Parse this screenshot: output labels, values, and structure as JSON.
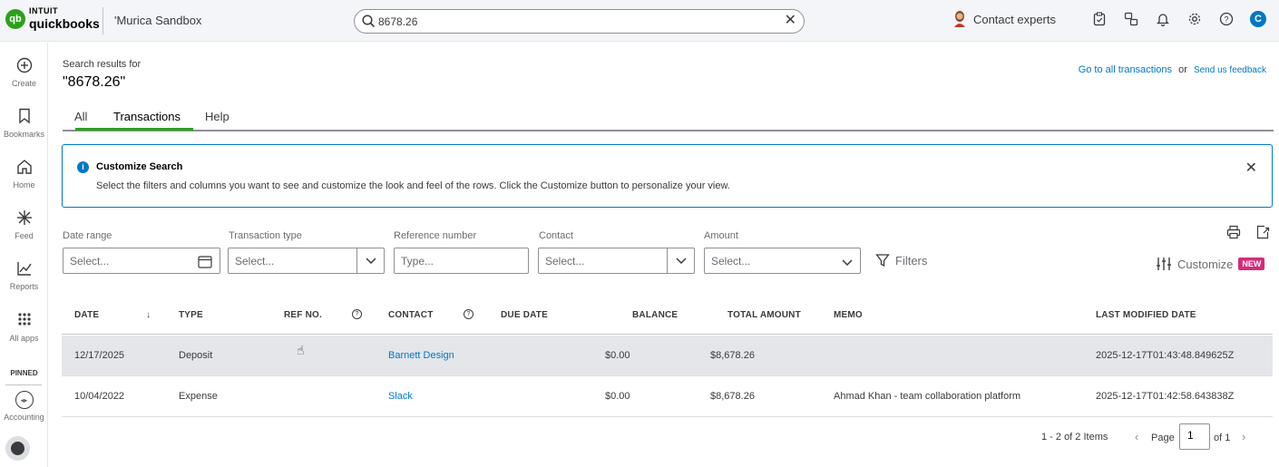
{
  "header": {
    "logo_intuit": "INTUIT",
    "logo_qb": "quickbooks",
    "company": "'Murica Sandbox",
    "search_value": "8678.26",
    "contact_experts": "Contact experts",
    "user_initial": "C"
  },
  "rail": {
    "items": [
      {
        "label": "Create"
      },
      {
        "label": "Bookmarks"
      },
      {
        "label": "Home"
      },
      {
        "label": "Feed"
      },
      {
        "label": "Reports"
      },
      {
        "label": "All apps"
      }
    ],
    "pinned_label": "PINNED",
    "pinned_items": [
      {
        "label": "Accounting"
      }
    ]
  },
  "main": {
    "search_results_label": "Search results for",
    "query": "\"8678.26\"",
    "go_to_all": "Go to all transactions",
    "or_text": "or",
    "feedback": "Send us feedback",
    "tabs": [
      {
        "label": "All"
      },
      {
        "label": "Transactions"
      },
      {
        "label": "Help"
      }
    ],
    "active_tab": "Transactions",
    "banner": {
      "title": "Customize Search",
      "text": "Select the filters and columns you want to see and customize the look and feel of the rows. Click the Customize button to personalize your view."
    },
    "filters": {
      "date_range": {
        "label": "Date range",
        "placeholder": "Select..."
      },
      "transaction_type": {
        "label": "Transaction type",
        "placeholder": "Select..."
      },
      "reference_number": {
        "label": "Reference number",
        "placeholder": "Type..."
      },
      "contact": {
        "label": "Contact",
        "placeholder": "Select..."
      },
      "amount": {
        "label": "Amount",
        "placeholder": "Select..."
      },
      "filters_button": "Filters",
      "customize_button": "Customize",
      "new_badge": "NEW"
    },
    "table": {
      "columns": {
        "date": "DATE",
        "sort_arrow": "↓",
        "type": "TYPE",
        "ref_no": "REF NO.",
        "contact": "CONTACT",
        "due_date": "DUE DATE",
        "balance": "BALANCE",
        "total_amount": "TOTAL AMOUNT",
        "memo": "MEMO",
        "last_modified": "LAST MODIFIED DATE"
      },
      "rows": [
        {
          "date": "12/17/2025",
          "type": "Deposit",
          "ref_no": "",
          "contact": "Barnett Design",
          "due_date": "",
          "balance": "$0.00",
          "total_amount": "$8,678.26",
          "memo": "",
          "last_modified": "2025-12-17T01:43:48.849625Z"
        },
        {
          "date": "10/04/2022",
          "type": "Expense",
          "ref_no": "",
          "contact": "Slack",
          "due_date": "",
          "balance": "$0.00",
          "total_amount": "$8,678.26",
          "memo": "Ahmad Khan - team collaboration platform",
          "last_modified": "2025-12-17T01:42:58.643838Z"
        }
      ]
    },
    "pagination": {
      "items_text": "1 - 2 of 2 Items",
      "page_label": "Page",
      "page_value": "1",
      "of_text": "of 1"
    }
  }
}
